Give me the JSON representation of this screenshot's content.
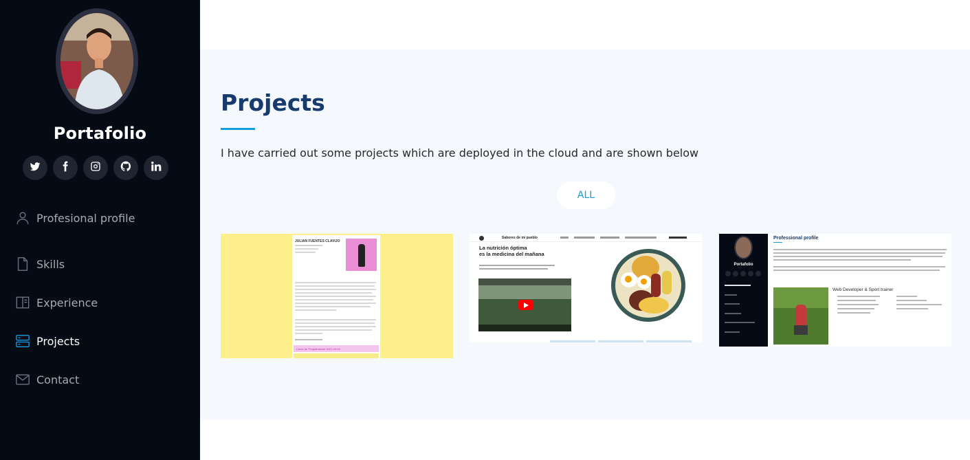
{
  "sidebar": {
    "brand": "Portafolio",
    "social": [
      {
        "icon": "twitter-icon"
      },
      {
        "icon": "facebook-icon"
      },
      {
        "icon": "instagram-icon"
      },
      {
        "icon": "github-icon"
      },
      {
        "icon": "linkedin-icon"
      }
    ],
    "nav": [
      {
        "label": "Profesional profile",
        "icon": "person-icon"
      },
      {
        "label": "Skills",
        "icon": "file-icon"
      },
      {
        "label": "Experience",
        "icon": "book-icon"
      },
      {
        "label": "Projects",
        "icon": "server-icon",
        "active": true
      },
      {
        "label": "Contact",
        "icon": "envelope-icon"
      }
    ]
  },
  "projects": {
    "title": "Projects",
    "description": "I have carried out some projects which are deployed in the cloud and are shown below",
    "filter_label": "ALL",
    "cards": [
      {
        "preview_name": "JULIAN FUENTES CLAVIJO",
        "preview_bar": "Curso de Programación 2021-04-03"
      },
      {
        "preview_title": "Sabores de mi pueblo",
        "preview_heading_1": "La nutrición óptima",
        "preview_heading_2": "es la medicina del mañana"
      },
      {
        "preview_brand": "Portafolio",
        "preview_title": "Professional profile",
        "preview_subtitle": "Web Developer & Sport trainer"
      }
    ]
  },
  "colors": {
    "sidebar_bg": "#040b14",
    "accent": "#149ddd",
    "heading": "#173b6c",
    "section_bg": "#f5f8fd"
  }
}
